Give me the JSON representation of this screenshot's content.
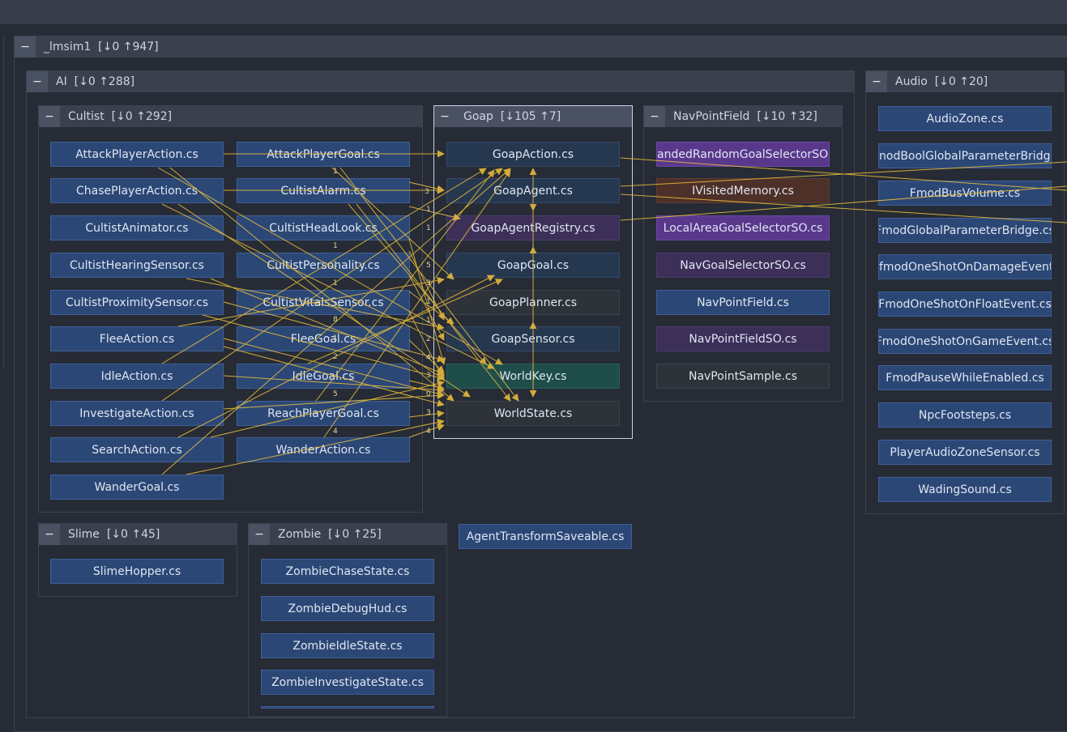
{
  "groups": {
    "root": {
      "name": "_lmsim1",
      "counts": "[↓0 ↑947]"
    },
    "ai": {
      "name": "AI",
      "counts": "[↓0 ↑288]"
    },
    "cultist": {
      "name": "Cultist",
      "counts": "[↓0 ↑292]"
    },
    "goap": {
      "name": "Goap",
      "counts": "[↓105 ↑7]"
    },
    "navpointfield": {
      "name": "NavPointField",
      "counts": "[↓10 ↑32]"
    },
    "audio": {
      "name": "Audio",
      "counts": "[↓0 ↑20]"
    },
    "slime": {
      "name": "Slime",
      "counts": "[↓0 ↑45]"
    },
    "zombie": {
      "name": "Zombie",
      "counts": "[↓0 ↑25]"
    }
  },
  "collapse_symbol": "−",
  "nodes": {
    "cultist_col1": [
      "AttackPlayerAction.cs",
      "ChasePlayerAction.cs",
      "CultistAnimator.cs",
      "CultistHearingSensor.cs",
      "CultistProximitySensor.cs",
      "FleeAction.cs",
      "IdleAction.cs",
      "InvestigateAction.cs",
      "SearchAction.cs",
      "WanderGoal.cs"
    ],
    "cultist_col2": [
      "AttackPlayerGoal.cs",
      "CultistAlarm.cs",
      "CultistHeadLook.cs",
      "CultistPersonality.cs",
      "CultistVitalsSensor.cs",
      "FleeGoal.cs",
      "IdleGoal.cs",
      "ReachPlayerGoal.cs",
      "WanderAction.cs"
    ],
    "goap": [
      "GoapAction.cs",
      "GoapAgent.cs",
      "GoapAgentRegistry.cs",
      "GoapGoal.cs",
      "GoapPlanner.cs",
      "GoapSensor.cs",
      "WorldKey.cs",
      "WorldState.cs"
    ],
    "navpointfield": [
      "andedRandomGoalSelectorSO.c",
      "IVisitedMemory.cs",
      "LocalAreaGoalSelectorSO.cs",
      "NavGoalSelectorSO.cs",
      "NavPointField.cs",
      "NavPointFieldSO.cs",
      "NavPointSample.cs"
    ],
    "audio": [
      "AudioZone.cs",
      "nodBoolGlobalParameterBridge.",
      "FmodBusVolume.cs",
      "FmodGlobalParameterBridge.cs",
      "fmodOneShotOnDamageEvent.c",
      "FmodOneShotOnFloatEvent.cs",
      "FmodOneShotOnGameEvent.cs",
      "FmodPauseWhileEnabled.cs",
      "NpcFootsteps.cs",
      "PlayerAudioZoneSensor.cs",
      "WadingSound.cs"
    ],
    "slime": [
      "SlimeHopper.cs"
    ],
    "zombie": [
      "ZombieChaseState.cs",
      "ZombieDebugHud.cs",
      "ZombieIdleState.cs",
      "ZombieInvestigateState.cs"
    ],
    "standalone": "AgentTransformSaveable.cs"
  },
  "edge_labels": [
    "3",
    "1",
    "1",
    "5",
    "3",
    "1",
    "1",
    "2",
    "4",
    "3",
    "0",
    "3",
    "4"
  ],
  "mid_labels": [
    "1",
    "1",
    "1",
    "1",
    "8",
    "1",
    "2",
    "5",
    "4"
  ],
  "colors": {
    "edge": "#f0c23c",
    "background": "#262b35",
    "node": "#2b4775"
  }
}
